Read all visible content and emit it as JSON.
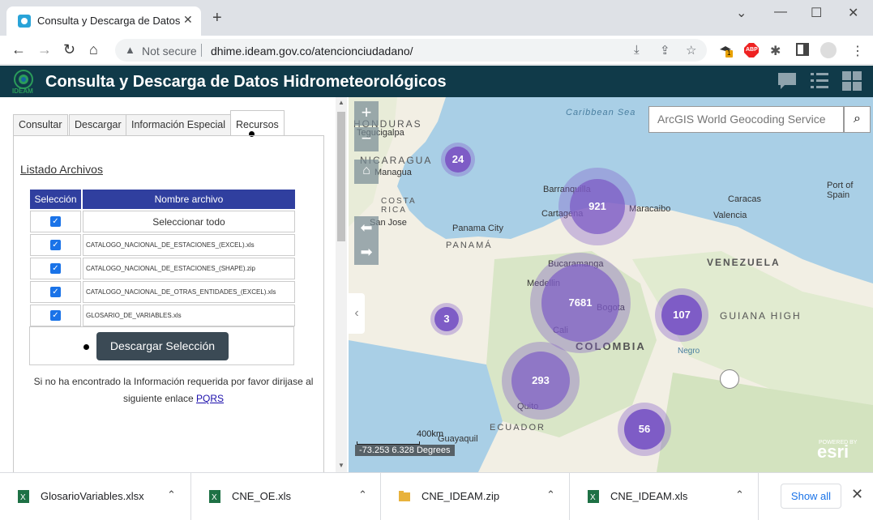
{
  "browser": {
    "tab_title": "Consulta y Descarga de Datos Hi",
    "not_secure": "Not secure",
    "url": "dhime.ideam.gov.co/atencionciudadano/",
    "ext_badge": "1",
    "abp": "ABP"
  },
  "app": {
    "logo_text": "IDEAM",
    "title": "Consulta y Descarga de Datos Hidrometeorológicos"
  },
  "panel": {
    "tabs": [
      "Consultar",
      "Descargar",
      "Información Especial",
      "Recursos"
    ],
    "listado_title": "Listado Archivos",
    "col_seleccion": "Selección",
    "col_nombre": "Nombre archivo",
    "select_all": "Seleccionar todo",
    "files": [
      "CATALOGO_NACIONAL_DE_ESTACIONES_(EXCEL).xls",
      "CATALOGO_NACIONAL_DE_ESTACIONES_(SHAPE).zip",
      "CATALOGO_NACIONAL_DE_OTRAS_ENTIDADES_(EXCEL).xls",
      "GLOSARIO_DE_VARIABLES.xls"
    ],
    "download_button": "Descargar Selección",
    "info_text": "Si no ha encontrado la Información requerida por favor dirijase al siguiente enlace",
    "pqrs_link": "PQRS"
  },
  "map": {
    "search_placeholder": "ArcGIS World Geocoding Service",
    "labels": {
      "caribbean": "Caribbean Sea",
      "honduras": "HONDURAS",
      "tegucigalpa": "Tegucigalpa",
      "nicaragua": "NICARAGUA",
      "managua": "Managua",
      "costa_rica": "COSTA RICA",
      "san_jose": "San Jose",
      "panama_city": "Panama City",
      "panama": "PANAMÁ",
      "barranquilla": "Barranquilla",
      "cartagena": "Cartagena",
      "maracaibo": "Maracaibo",
      "caracas": "Caracas",
      "valencia": "Valencia",
      "port_of_spain": "Port of Spain",
      "venezuela": "VENEZUELA",
      "bucaramanga": "Bucaramanga",
      "medellin": "Medellin",
      "bogota": "Bogota",
      "cali": "Cali",
      "colombia": "COLOMBIA",
      "guiana": "GUIANA HIGH",
      "negro": "Negro",
      "quito": "Quito",
      "ecuador": "ECUADOR",
      "guayaquil": "Guayaquil"
    },
    "clusters": [
      {
        "count": "24"
      },
      {
        "count": "921"
      },
      {
        "count": "7681"
      },
      {
        "count": "3"
      },
      {
        "count": "107"
      },
      {
        "count": "293"
      },
      {
        "count": "56"
      }
    ],
    "scale_label": "400km",
    "coordinates": "-73.253 6.328 Degrees",
    "powered_by": "POWERED BY",
    "esri": "esri"
  },
  "downloads": {
    "items": [
      {
        "name": "GlosarioVariables.xlsx",
        "icon": "excel-icon"
      },
      {
        "name": "CNE_OE.xls",
        "icon": "excel-icon"
      },
      {
        "name": "CNE_IDEAM.zip",
        "icon": "zip-folder-icon"
      },
      {
        "name": "CNE_IDEAM.xls",
        "icon": "excel-icon"
      }
    ],
    "show_all": "Show all"
  }
}
